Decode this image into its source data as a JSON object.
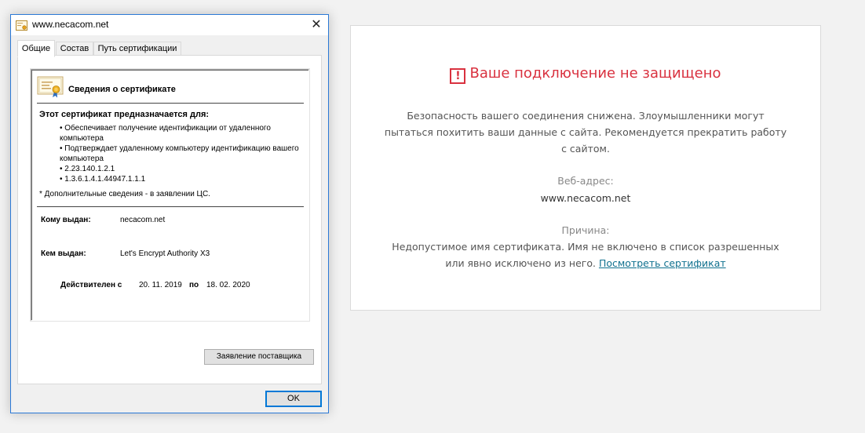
{
  "dialog": {
    "title": "www.necacom.net",
    "close_glyph": "✕",
    "tabs": [
      {
        "label": "Общие"
      },
      {
        "label": "Состав"
      },
      {
        "label": "Путь сертификации"
      }
    ],
    "heading": "Сведения о сертификате",
    "purpose_title": "Этот сертификат предназначается для:",
    "purposes": [
      "• Обеспечивает получение идентификации от удаленного компьютера",
      "• Подтверждает удаленному компьютеру идентификацию вашего компьютера",
      "• 2.23.140.1.2.1",
      "• 1.3.6.1.4.1.44947.1.1.1"
    ],
    "footnote": "* Дополнительные сведения - в заявлении ЦС.",
    "issued_to_label": "Кому выдан:",
    "issued_to_value": "necacom.net",
    "issued_by_label": "Кем выдан:",
    "issued_by_value": "Let's Encrypt Authority X3",
    "valid_label": "Действителен с",
    "valid_from": "20. 11. 2019",
    "valid_to_label": "по",
    "valid_to": "18. 02. 2020",
    "issuer_statement_button": "Заявление поставщика",
    "ok_button": "OK"
  },
  "warning": {
    "icon_glyph": "!",
    "title": "Ваше подключение не защищено",
    "description": "Безопасность вашего соединения снижена. Злоумышленники могут пытаться похитить ваши данные с сайта. Рекомендуется прекратить работу с сайтом.",
    "address_label": "Веб-адрес:",
    "address_value": "www.necacom.net",
    "reason_label": "Причина:",
    "reason_text": "Недопустимое имя сертификата. Имя не включено в список разрешенных или явно исключено из него.",
    "view_certificate_link": "Посмотреть сертификат"
  },
  "colors": {
    "warning_red": "#d9313f",
    "link_teal": "#10718f",
    "dialog_border": "#2b79d6",
    "ok_focus": "#0078d7"
  }
}
